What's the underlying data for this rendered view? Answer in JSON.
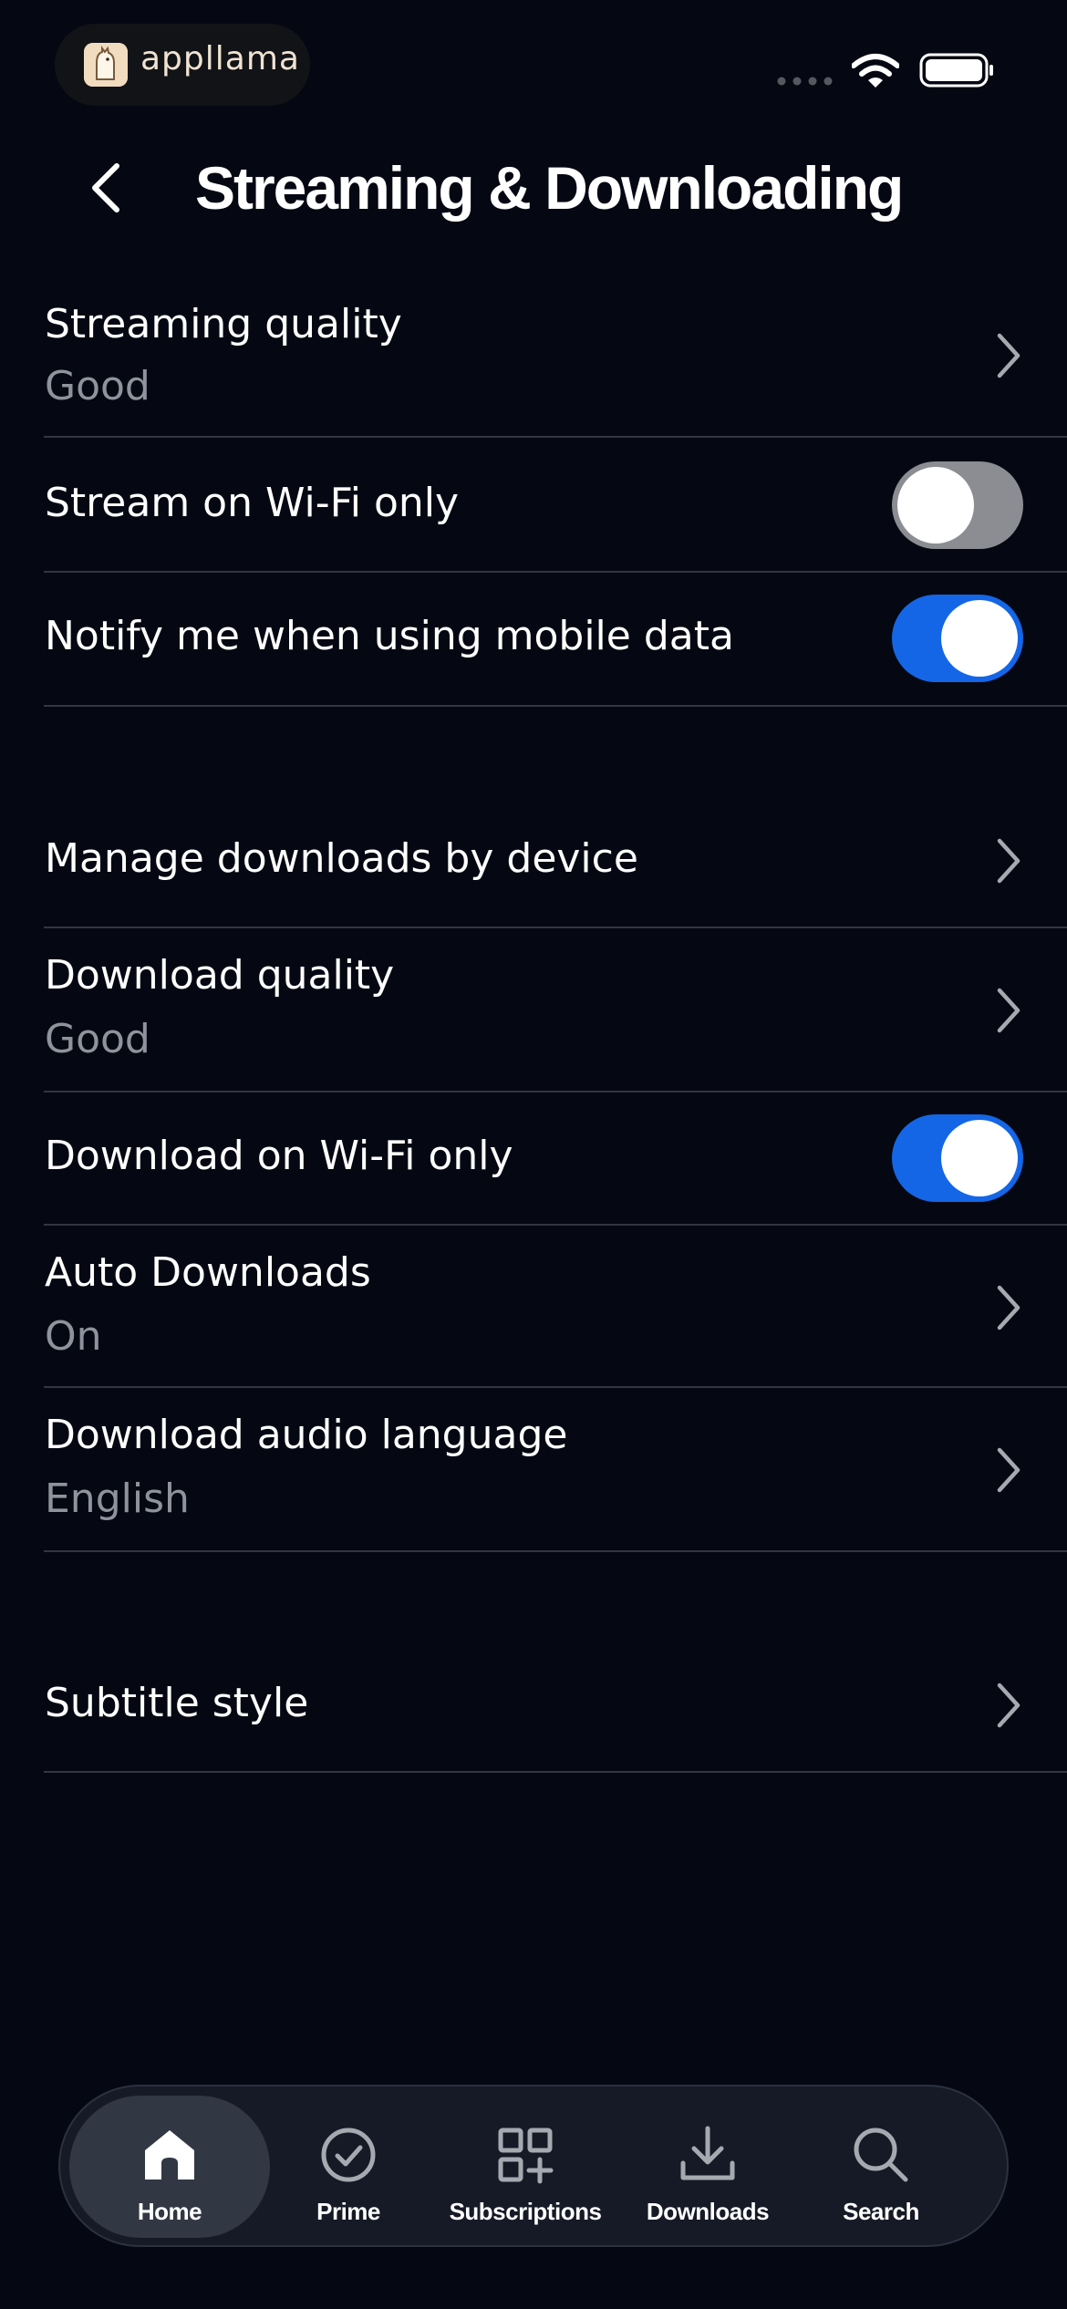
{
  "status_bar": {
    "brand_name": "appllama"
  },
  "header": {
    "title": "Streaming & Downloading"
  },
  "settings": {
    "streaming_quality": {
      "label": "Streaming quality",
      "value": "Good"
    },
    "stream_wifi_only": {
      "label": "Stream on Wi-Fi only",
      "enabled": false
    },
    "notify_mobile_data": {
      "label": "Notify me when using mobile data",
      "enabled": true
    },
    "manage_downloads": {
      "label": "Manage downloads by device"
    },
    "download_quality": {
      "label": "Download quality",
      "value": "Good"
    },
    "download_wifi_only": {
      "label": "Download on Wi-Fi only",
      "enabled": true
    },
    "auto_downloads": {
      "label": "Auto Downloads",
      "value": "On"
    },
    "download_audio_language": {
      "label": "Download audio language",
      "value": "English"
    },
    "subtitle_style": {
      "label": "Subtitle style"
    }
  },
  "bottom_nav": {
    "active": "Home",
    "items": [
      {
        "label": "Home",
        "icon": "home-icon"
      },
      {
        "label": "Prime",
        "icon": "check-circle-icon"
      },
      {
        "label": "Subscriptions",
        "icon": "grid-plus-icon"
      },
      {
        "label": "Downloads",
        "icon": "download-icon"
      },
      {
        "label": "Search",
        "icon": "search-icon"
      }
    ]
  },
  "colors": {
    "background": "#050812",
    "accent_toggle": "#1466e6",
    "toggle_off": "#8b8d92",
    "secondary_text": "#8f939b",
    "divider": "#33363e"
  }
}
